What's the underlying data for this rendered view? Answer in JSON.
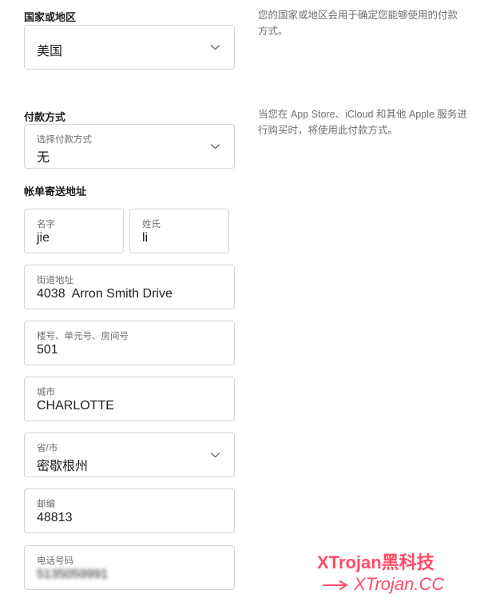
{
  "country": {
    "title": "国家或地区",
    "help": "您的国家或地区会用于确定您能够使用的付款方式。",
    "selected": "美国"
  },
  "payment": {
    "title": "付款方式",
    "help": "当您在 App Store、iCloud 和其他 Apple 服务进行购买时，将使用此付款方式。",
    "select_label": "选择付款方式",
    "selected": "无"
  },
  "billing": {
    "title": "帐单寄送地址",
    "first_name": {
      "label": "名字",
      "value": "jie"
    },
    "last_name": {
      "label": "姓氏",
      "value": "li"
    },
    "street": {
      "label": "街道地址",
      "value": "4038  Arron Smith Drive"
    },
    "unit": {
      "label": "楼号、单元号、房间号",
      "value": "501"
    },
    "city": {
      "label": "城市",
      "value": "CHARLOTTE"
    },
    "state": {
      "label": "省/市",
      "value": "密歇根州"
    },
    "zip": {
      "label": "邮编",
      "value": "48813"
    },
    "phone": {
      "label": "电话号码",
      "value": "5135059991"
    }
  },
  "watermark": {
    "line1": "XTrojan黑科技",
    "line2": "XTrojan.CC"
  },
  "colors": {
    "border": "#d2d2d7",
    "label": "#6e6e73",
    "text": "#1d1d1f",
    "watermark": "#ff4b6a"
  },
  "icons": {
    "dropdown": "chevron-down-icon",
    "watermark_arrow": "arrow-right-icon"
  }
}
